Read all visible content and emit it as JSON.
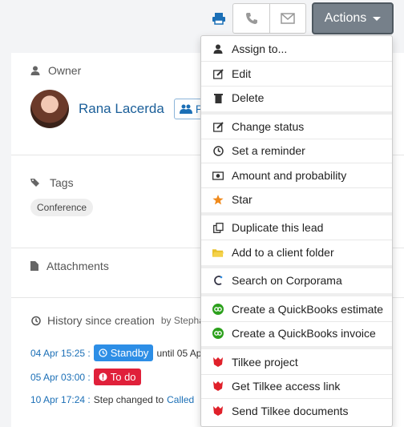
{
  "toolbar": {
    "print_icon": "print-icon",
    "phone_icon": "phone-icon",
    "mail_icon": "envelope-icon",
    "actions_label": "Actions"
  },
  "owner": {
    "label": "Owner",
    "name": "Rana Lacerda",
    "team_badge": "Pro"
  },
  "tags": {
    "label": "Tags",
    "items": [
      "Conference"
    ]
  },
  "attachments": {
    "label": "Attachments"
  },
  "history": {
    "title": "History since creation",
    "by": "by Stepha",
    "rows": [
      {
        "date": "04 Apr 15:25 :",
        "badge": "Standby",
        "suffix": "until 05 Ap"
      },
      {
        "date": "05 Apr 03:00 :",
        "badge": "To do"
      },
      {
        "date": "10 Apr 17:24 :",
        "text": "Step changed to",
        "link": "Called"
      }
    ]
  },
  "menu": {
    "items": [
      {
        "label": "Assign to...",
        "icon": "user-icon"
      },
      {
        "label": "Edit",
        "icon": "edit-icon"
      },
      {
        "label": "Delete",
        "icon": "trash-icon"
      },
      {
        "label": "Change status",
        "icon": "edit-icon"
      },
      {
        "label": "Set a reminder",
        "icon": "clock-icon"
      },
      {
        "label": "Amount and probability",
        "icon": "money-icon"
      },
      {
        "label": "Star",
        "icon": "star-icon"
      },
      {
        "label": "Duplicate this lead",
        "icon": "copy-icon"
      },
      {
        "label": "Add to a client folder",
        "icon": "folder-icon"
      },
      {
        "label": "Search on Corporama",
        "icon": "corporama-icon"
      },
      {
        "label": "Create a QuickBooks estimate",
        "icon": "quickbooks-icon"
      },
      {
        "label": "Create a QuickBooks invoice",
        "icon": "quickbooks-icon"
      },
      {
        "label": "Tilkee project",
        "icon": "tilkee-icon"
      },
      {
        "label": "Get Tilkee access link",
        "icon": "tilkee-icon"
      },
      {
        "label": "Send Tilkee documents",
        "icon": "tilkee-icon"
      }
    ]
  },
  "colors": {
    "accent": "#1b6fb6",
    "actions_bg": "#76808a",
    "standby": "#2d8ee6",
    "todo": "#e0203a",
    "star": "#f08a1c",
    "folder": "#e8c02a",
    "quickbooks": "#2ca01c",
    "tilkee": "#e0202a"
  }
}
